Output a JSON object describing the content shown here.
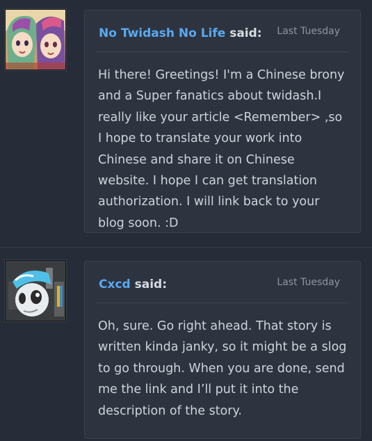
{
  "comments": [
    {
      "author": "No Twidash No Life",
      "said": "said:",
      "timestamp": "Last Tuesday",
      "text": "Hi there! Greetings! I'm a Chinese brony and a Super fanatics about twidash.I really like your article <Remember> ,so I hope to translate your work into Chinese and share it on Chinese website. I hope I can get translation authorization. I will link back to your blog soon. :D",
      "avatar_icon": "anime-girls-avatar"
    },
    {
      "author": "Cxcd",
      "said": "said:",
      "timestamp": "Last Tuesday",
      "text": "Oh, sure. Go right ahead. That story is written kinda janky, so it might be a slog to go through. When you are done, send me the link and I’ll put it into the description of the story.",
      "avatar_icon": "pony-avatar"
    }
  ],
  "colors": {
    "background": "#262d38",
    "bubble": "#2d3440",
    "author_link": "#5aa9f0",
    "text": "#cfd3da",
    "timestamp": "#8f96a3"
  }
}
